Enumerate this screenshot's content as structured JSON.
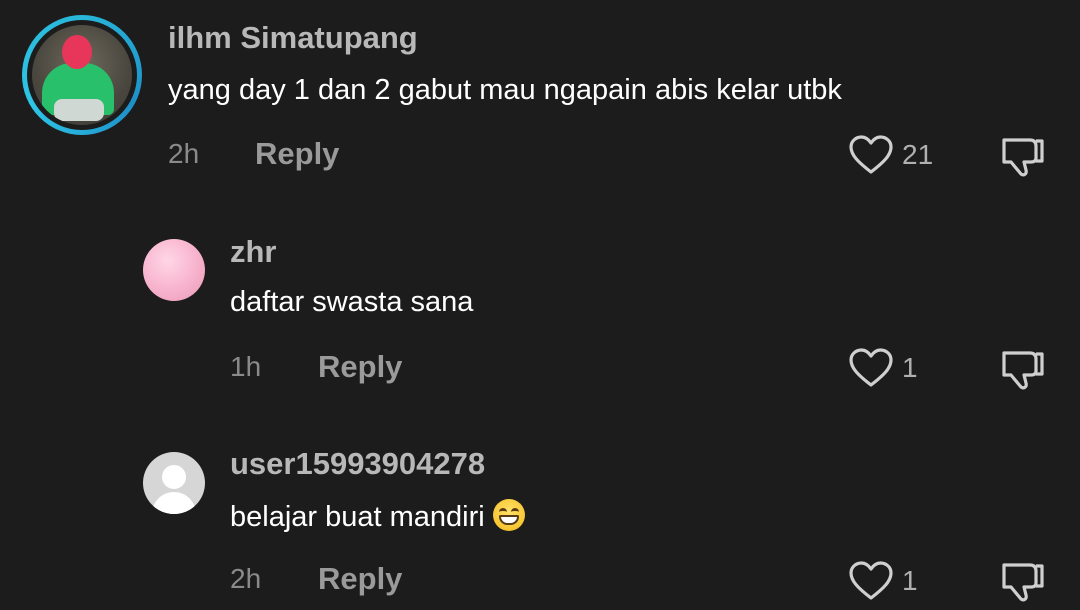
{
  "comments": [
    {
      "username": "ilhm Simatupang",
      "text": "yang day 1 dan 2 gabut mau ngapain abis kelar utbk",
      "time": "2h",
      "reply_label": "Reply",
      "likes": "21",
      "avatar": "profile-photo-with-story-ring"
    },
    {
      "username": "zhr",
      "text": "daftar swasta sana",
      "time": "1h",
      "reply_label": "Reply",
      "likes": "1",
      "avatar": "pink-gradient-avatar"
    },
    {
      "username": "user15993904278",
      "text": "belajar buat mandiri",
      "emoji": "grinning-face-emoji",
      "time": "2h",
      "reply_label": "Reply",
      "likes": "1",
      "avatar": "default-user-avatar"
    }
  ],
  "colors": {
    "background": "#1c1c1c",
    "username": "#b8b8b8",
    "text": "#ffffff",
    "meta": "#8a8a8a",
    "story_ring": "#29b6d8"
  }
}
